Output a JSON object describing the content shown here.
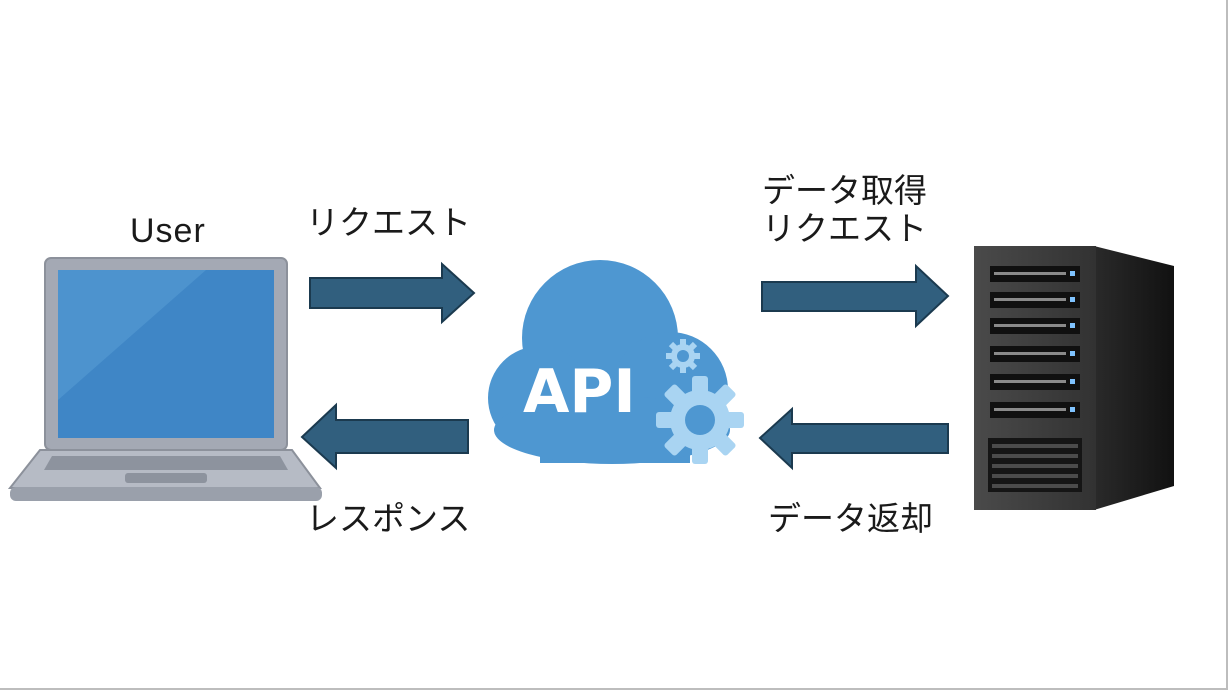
{
  "labels": {
    "user": "User",
    "request": "リクエスト",
    "response": "レスポンス",
    "data_fetch_line1": "データ取得",
    "data_fetch_line2": "リクエスト",
    "data_return": "データ返却",
    "api": "API"
  },
  "colors": {
    "arrow_fill": "#315f7e",
    "arrow_stroke": "#1b3a4f",
    "cloud": "#4e97d1",
    "gear": "#a9d4f2",
    "laptop_body": "#a4a9b4",
    "laptop_screen": "#3f86c6",
    "server_front": "#3b3b3b",
    "server_side": "#1b1b1b"
  },
  "icons": {
    "laptop": "laptop-icon",
    "cloud": "api-cloud-icon",
    "gear": "gear-icon",
    "server": "server-icon"
  }
}
